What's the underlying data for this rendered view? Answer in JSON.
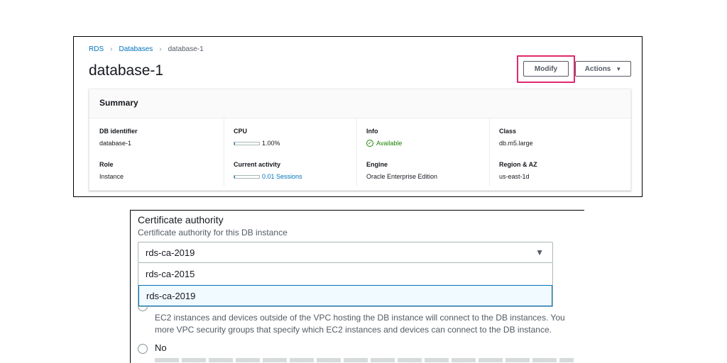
{
  "breadcrumb": {
    "items": [
      "RDS",
      "Databases",
      "database-1"
    ]
  },
  "page_title": "database-1",
  "toolbar": {
    "modify_label": "Modify",
    "actions_label": "Actions"
  },
  "summary": {
    "title": "Summary",
    "fields": {
      "db_identifier": {
        "label": "DB identifier",
        "value": "database-1"
      },
      "cpu": {
        "label": "CPU",
        "value": "1.00%",
        "percent": 1.0
      },
      "info": {
        "label": "Info",
        "value": "Available"
      },
      "class": {
        "label": "Class",
        "value": "db.m5.large"
      },
      "role": {
        "label": "Role",
        "value": "Instance"
      },
      "current_activity": {
        "label": "Current activity",
        "value": "0.01 Sessions",
        "fraction": 0.01
      },
      "engine": {
        "label": "Engine",
        "value": "Oracle Enterprise Edition"
      },
      "region_az": {
        "label": "Region & AZ",
        "value": "us-east-1d"
      }
    }
  },
  "certificate": {
    "title": "Certificate authority",
    "description": "Certificate authority for this DB instance",
    "selected": "rds-ca-2019",
    "options": [
      "rds-ca-2015",
      "rds-ca-2019"
    ],
    "help_line_1": "EC2 instances and devices outside of the VPC hosting the DB instance will connect to the DB instances. You",
    "help_line_2": "more VPC security groups that specify which EC2 instances and devices can connect to the DB instance.",
    "radio_no_label": "No"
  },
  "colors": {
    "link": "#0073bb",
    "available": "#1d8102",
    "highlight": "#e0286c"
  }
}
